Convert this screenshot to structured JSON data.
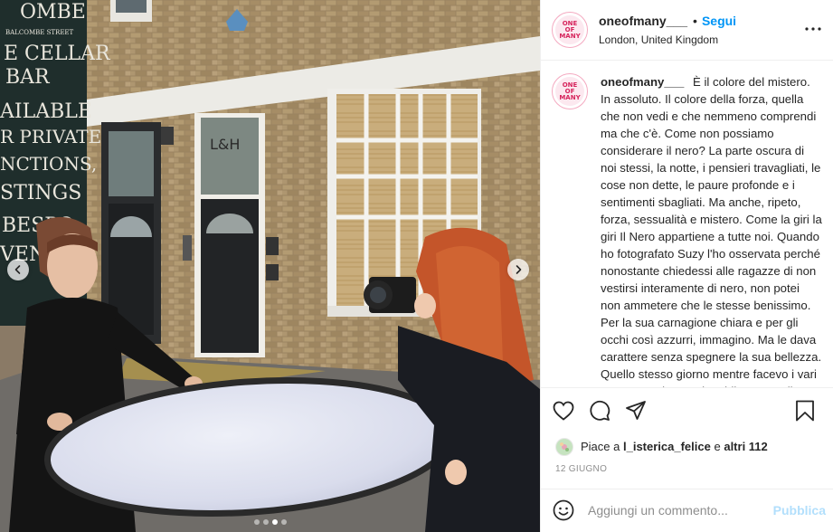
{
  "post": {
    "author": {
      "username": "oneofmany___",
      "avatar_text": [
        "ONE",
        "OF",
        "MANY"
      ]
    },
    "header": {
      "separator": "•",
      "follow_label": "Segui",
      "location": "London, United Kingdom"
    },
    "photo": {
      "sign_lines": [
        "OMBE",
        "BALCOMBE STREET",
        "E CELLAR",
        "BAR",
        "AILABLE",
        "R PRIVATE",
        "NCTIONS,",
        "STINGS",
        "BESPO",
        "VEN"
      ],
      "door_sign": "L&H"
    },
    "caption": "È il colore del mistero. In assoluto. Il colore della forza, quella che non vedi e che nemmeno comprendi ma che c'è. Come non possiamo considerare il nero? La parte oscura di noi stessi, la notte, i pensieri travagliati, le cose non dette, le paure profonde e i sentimenti sbagliati. Ma anche, ripeto, forza, sessualità e mistero. Come la giri la giri Il Nero appartiene a tutte noi. Quando ho fotografato Suzy l'ho osservata perché nonostante chiedessi alle ragazze di non vestirsi interamente di nero, non potei non ammetere che le stesse benissimo. Per la sua carnagione chiara e per gli occhi così azzurri, immagino. Ma le dava carattere senza spegnere la sua bellezza. Quello stesso giorno mentre facevo i vari spostamenti a Londra vidi un vassello",
    "likes": {
      "prefix": "Piace a",
      "user": "l_isterica_felice",
      "connector": "e",
      "others": "altri 112"
    },
    "date": "12 GIUGNO",
    "comment": {
      "placeholder": "Aggiungi un commento...",
      "publish_label": "Pubblica"
    },
    "carousel": {
      "count": 4,
      "active_index": 2
    }
  },
  "icons": {
    "prev": "chevron-left-icon",
    "next": "chevron-right-icon",
    "more": "more-horizontal-icon",
    "like": "heart-icon",
    "comment": "comment-icon",
    "share": "share-icon",
    "save": "bookmark-icon",
    "emoji": "emoji-icon"
  },
  "colors": {
    "follow": "#0095f6",
    "publish_disabled": "#b2dffc",
    "muted": "#8e8e8e",
    "avatar_ring": "#f4a9c0",
    "brand": "#d6245c"
  }
}
